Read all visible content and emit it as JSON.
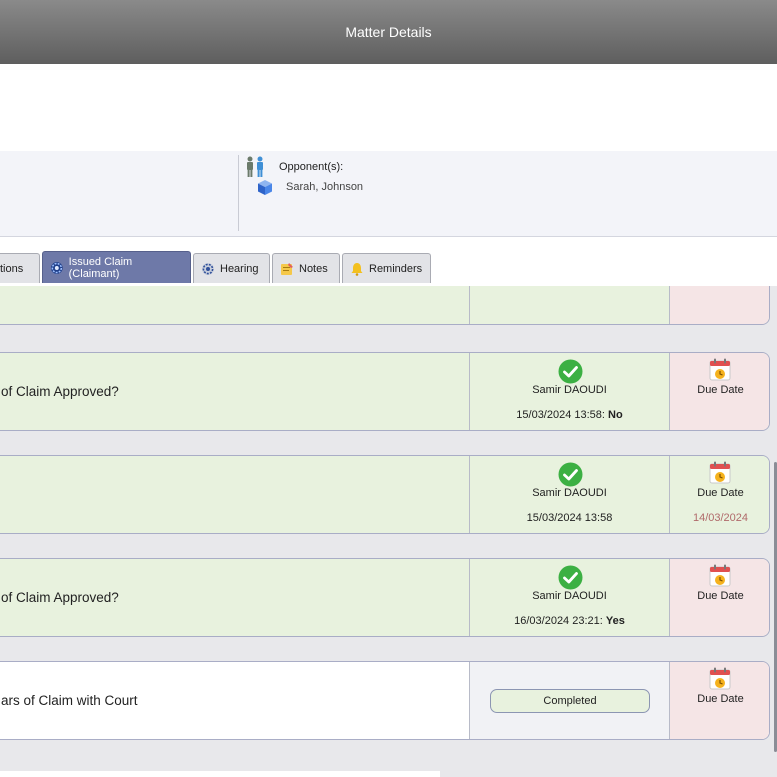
{
  "header": {
    "title": "Matter Details"
  },
  "opponents": {
    "label": "Opponent(s):",
    "value": "Sarah, Johnson"
  },
  "tabs": [
    {
      "label": "tions",
      "active": false,
      "icon": ""
    },
    {
      "label": "Issued Claim (Claimant)",
      "active": true,
      "icon": "gear-icon"
    },
    {
      "label": "Hearing",
      "active": false,
      "icon": "gear-icon"
    },
    {
      "label": "Notes",
      "active": false,
      "icon": "note-icon"
    },
    {
      "label": "Reminders",
      "active": false,
      "icon": "bell-icon"
    }
  ],
  "cards": [
    {
      "title": "of Claim Approved?",
      "user": "Samir DAOUDI",
      "timestamp": "15/03/2024 13:58:",
      "answer": "No",
      "due_label": "Due Date",
      "due_date": ""
    },
    {
      "title": "",
      "user": "Samir DAOUDI",
      "timestamp": "15/03/2024 13:58",
      "answer": "",
      "due_label": "Due Date",
      "due_date": "14/03/2024"
    },
    {
      "title": "of Claim Approved?",
      "user": "Samir DAOUDI",
      "timestamp": "16/03/2024 23:21:",
      "answer": "Yes",
      "due_label": "Due Date",
      "due_date": ""
    },
    {
      "title": "ars of Claim with Court",
      "status": "Completed",
      "due_label": "Due Date"
    }
  ],
  "colors": {
    "accent": "#6e79a8",
    "complete_bg": "#e8f2de",
    "due_bg": "#f5e5e6",
    "check": "#3cb043",
    "due_date_text": "#b06a6a"
  }
}
